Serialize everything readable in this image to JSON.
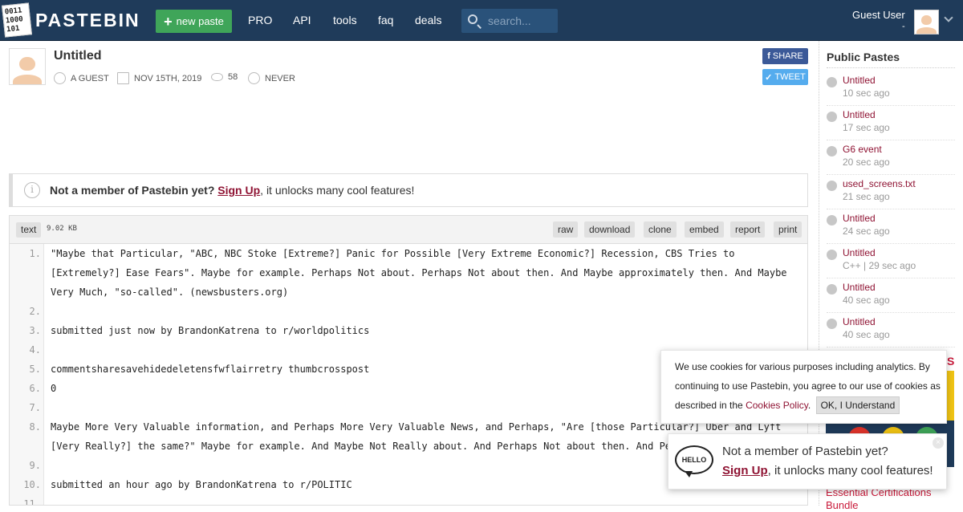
{
  "header": {
    "logo_bits": [
      "0011",
      "1000",
      "101"
    ],
    "logo_text": "PASTEBIN",
    "new_paste_label": "new paste",
    "nav": [
      "PRO",
      "API",
      "tools",
      "faq",
      "deals"
    ],
    "search_placeholder": "search...",
    "user_name": "Guest User",
    "user_sub": "-"
  },
  "paste": {
    "title": "Untitled",
    "author": "A GUEST",
    "date": "NOV 15TH, 2019",
    "views": "58",
    "expires": "NEVER",
    "share_label": "SHARE",
    "tweet_label": "TWEET"
  },
  "notice": {
    "bold": "Not a member of Pastebin yet?",
    "link": "Sign Up",
    "rest": ", it unlocks many cool features!"
  },
  "code": {
    "language": "text",
    "size": "9.02 KB",
    "actions": [
      "raw",
      "download",
      "clone",
      "embed",
      "report",
      "print"
    ],
    "lines": [
      {
        "n": "1.",
        "text": "\"Maybe that Particular, \"ABC, NBC Stoke [Extreme?] Panic for Possible [Very Extreme Economic?] Recession, CBS Tries to [Extremely?] Ease Fears\". Maybe for example. Perhaps Not about. Perhaps Not about then. And Maybe approximately then. And Maybe Very Much, \"so-called\". (newsbusters.org)"
      },
      {
        "n": "2.",
        "text": ""
      },
      {
        "n": "3.",
        "text": "submitted just now by BrandonKatrena to r/worldpolitics"
      },
      {
        "n": "4.",
        "text": ""
      },
      {
        "n": "5.",
        "text": "commentsharesavehidedeletensfwflairretry thumbcrosspost"
      },
      {
        "n": "6.",
        "text": "0"
      },
      {
        "n": "7.",
        "text": ""
      },
      {
        "n": "8.",
        "text": "Maybe More Very Valuable information, and Perhaps More Very Valuable News, and Perhaps, \"Are [those Particular?] Uber and Lyft [Very Really?] the same?\" Maybe for example. And Maybe Not Really about. And Perhaps Not about then. And Perhaps, \"s"
      },
      {
        "n": "9.",
        "text": ""
      },
      {
        "n": "10.",
        "text": "submitted an hour ago by BrandonKatrena to r/POLITIC"
      },
      {
        "n": "11.",
        "text": ""
      }
    ]
  },
  "sidebar": {
    "title": "Public Pastes",
    "items": [
      {
        "name": "Untitled",
        "time": "10 sec ago"
      },
      {
        "name": "Untitled",
        "time": "17 sec ago"
      },
      {
        "name": "G6 event",
        "time": "20 sec ago"
      },
      {
        "name": "used_screens.txt",
        "time": "21 sec ago"
      },
      {
        "name": "Untitled",
        "time": "24 sec ago"
      },
      {
        "name": "Untitled",
        "time": "C++ | 29 sec ago"
      },
      {
        "name": "Untitled",
        "time": "40 sec ago"
      },
      {
        "name": "Untitled",
        "time": "40 sec ago"
      }
    ],
    "ad_fragment": "S",
    "ad_title": "Essential Certifications Bundle"
  },
  "cookie": {
    "text": "We use cookies for various purposes including analytics. By continuing to use Pastebin, you agree to our use of cookies as described in the ",
    "link": "Cookies Policy",
    "period": ".",
    "ok": "OK, I Understand"
  },
  "hello": {
    "badge": "HELLO",
    "question": "Not a member of Pastebin yet?",
    "link": "Sign Up",
    "rest": ", it unlocks many cool features!",
    "close": "×"
  }
}
